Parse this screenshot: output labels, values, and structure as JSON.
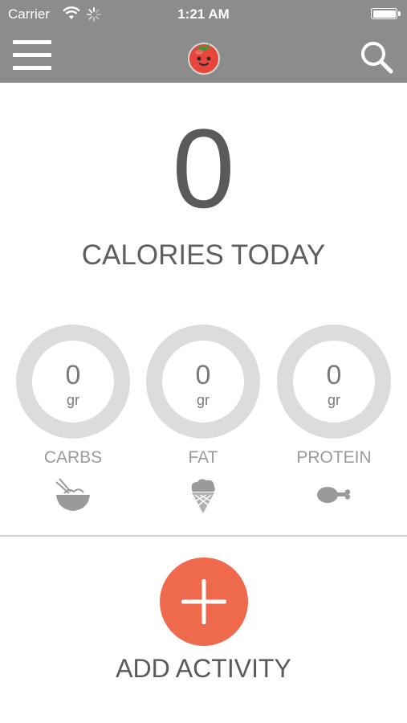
{
  "status_bar": {
    "carrier": "Carrier",
    "time": "1:21 AM"
  },
  "header": {
    "menu_icon": "hamburger-menu-icon",
    "logo_icon": "tomato-mascot-logo",
    "search_icon": "search-icon"
  },
  "calories": {
    "value": "0",
    "label": "CALORIES TODAY"
  },
  "macros": [
    {
      "value": "0",
      "unit": "gr",
      "label": "CARBS",
      "icon": "noodle-bowl-icon"
    },
    {
      "value": "0",
      "unit": "gr",
      "label": "FAT",
      "icon": "ice-cream-cone-icon"
    },
    {
      "value": "0",
      "unit": "gr",
      "label": "PROTEIN",
      "icon": "chicken-drumstick-icon"
    }
  ],
  "add_activity": {
    "label": "ADD ACTIVITY"
  },
  "colors": {
    "header_bg": "#8c8c8c",
    "accent": "#ef6a4d",
    "ring": "#dcdcdc",
    "text": "#5c5c5c"
  }
}
